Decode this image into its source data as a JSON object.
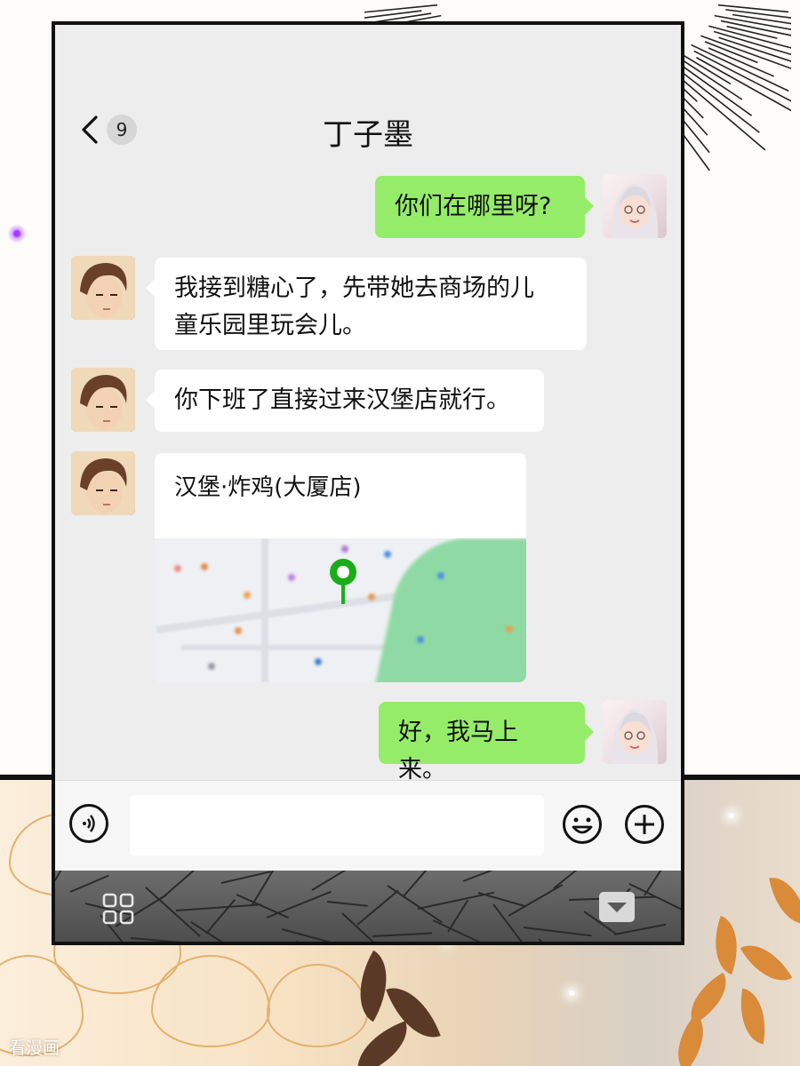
{
  "header": {
    "back_label": "back",
    "unread_count": "9",
    "contact_name": "丁子墨"
  },
  "messages": [
    {
      "id": 1,
      "sender": "me",
      "type": "text",
      "text": "你们在哪里呀?"
    },
    {
      "id": 2,
      "sender": "contact",
      "type": "text",
      "text": "我接到糖心了，先带她去商场的儿\n童乐园里玩会儿。"
    },
    {
      "id": 3,
      "sender": "contact",
      "type": "text",
      "text": "你下班了直接过来汉堡店就行。"
    },
    {
      "id": 4,
      "sender": "contact",
      "type": "location",
      "text": "汉堡·炸鸡(大厦店)"
    },
    {
      "id": 5,
      "sender": "me",
      "type": "text",
      "text": "好，我马上来。"
    }
  ],
  "input": {
    "placeholder": ""
  },
  "icons": {
    "back": "chevron-left-icon",
    "voice": "voice-icon",
    "emoji": "emoji-icon",
    "plus": "plus-icon",
    "grid": "grid-menu-icon",
    "collapse": "collapse-down-icon",
    "map_pin": "map-pin-icon"
  },
  "colors": {
    "outgoing_bubble": "#95ec69",
    "incoming_bubble": "#ffffff",
    "chat_background": "#ededed",
    "map_pin": "#1aad19"
  },
  "watermark": "看漫画"
}
